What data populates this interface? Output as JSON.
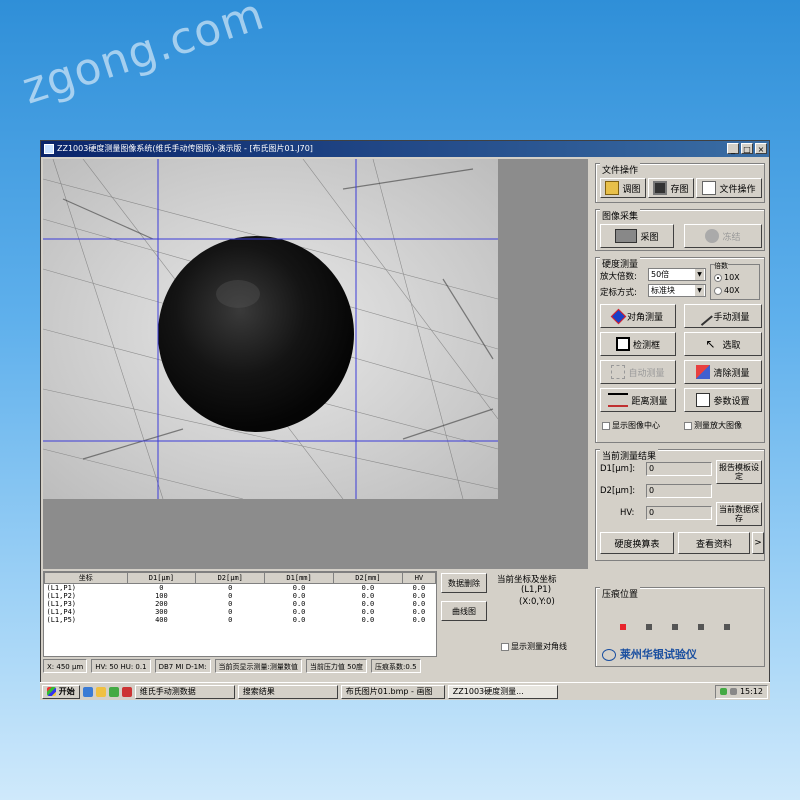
{
  "watermark": "zgong.com",
  "window": {
    "title": "ZZ1003硬度测量图像系统(维氏手动传图版)-演示版 - [布氏图片01.J70]",
    "controls": [
      "_",
      "□",
      "×"
    ]
  },
  "panel": {
    "file_ops": {
      "title": "文件操作",
      "open": "调图",
      "save": "存图",
      "file_op": "文件操作"
    },
    "image_capture": {
      "title": "图像采集",
      "capture": "采图",
      "freeze": "冻结"
    },
    "hardness": {
      "title": "硬度测量",
      "magnification_label": "放大倍数:",
      "magnification_value": "50倍",
      "method_label": "定标方式:",
      "method_value": "标准块",
      "radio_group_title": "倍数",
      "radio_1": "10X",
      "radio_2": "40X",
      "btn_diagonal": "对角测量",
      "btn_manual": "手动测量",
      "btn_measure": "检测框",
      "btn_select": "选取",
      "btn_auto": "自动测量",
      "btn_clear": "清除测量",
      "btn_distance": "距离测量",
      "btn_params": "参数设置",
      "chk_center": "显示图像中心",
      "chk_zoom": "测量放大图像"
    },
    "results": {
      "title": "当前测量结果",
      "d1_label": "D1[μm]:",
      "d1_value": "0",
      "d2_label": "D2[μm]:",
      "d2_value": "0",
      "hv_label": "HV:",
      "hv_value": "0",
      "btn_report": "报告模板设定",
      "btn_save_data": "当前数据保存",
      "btn_convert": "硬度换算表",
      "btn_query": "查看资料",
      "btn_more": ">"
    }
  },
  "table": {
    "headers": [
      "坐标",
      "D1[μm]",
      "D2[μm]",
      "D1[mm]",
      "D2[mm]",
      "HV"
    ],
    "rows": [
      [
        "(L1,P1)",
        "0",
        "0",
        "0.0",
        "0.0",
        "0.0"
      ],
      [
        "(L1,P2)",
        "100",
        "0",
        "0.0",
        "0.0",
        "0.0"
      ],
      [
        "(L1,P3)",
        "200",
        "0",
        "0.0",
        "0.0",
        "0.0"
      ],
      [
        "(L1,P4)",
        "300",
        "0",
        "0.0",
        "0.0",
        "0.0"
      ],
      [
        "(L1,P5)",
        "400",
        "0",
        "0.0",
        "0.0",
        "0.0"
      ]
    ]
  },
  "middle": {
    "btn_delete": "数据删除",
    "btn_curve": "曲线图",
    "coord_title": "当前坐标及坐标",
    "coord_line1": "(L1,P1)",
    "coord_line2": "(X:0,Y:0)",
    "chk_curve": "显示测量对角线"
  },
  "pressure": {
    "title": "压痕位置",
    "dots": [
      "active",
      "idle",
      "idle",
      "idle",
      "idle"
    ]
  },
  "status": {
    "items": [
      "X: 450 μm",
      "HV: 50  HU: 0.1",
      "DB7  MI  D-1M:",
      "当前页显示测量:测量数值",
      "当前压力值 50度",
      "压痕系数:0.5"
    ]
  },
  "brand": "莱州华银试验仪",
  "taskbar": {
    "start": "开始",
    "items": [
      "维氏手动测数据",
      "搜索结果",
      "布氏图片01.bmp - 画图",
      "ZZ1003硬度测量..."
    ],
    "clock": "15:12"
  },
  "colors": {
    "title_gradient_start": "#0a246a",
    "accent_dot": "#e8242c",
    "desktop": "#5fb0ec"
  }
}
